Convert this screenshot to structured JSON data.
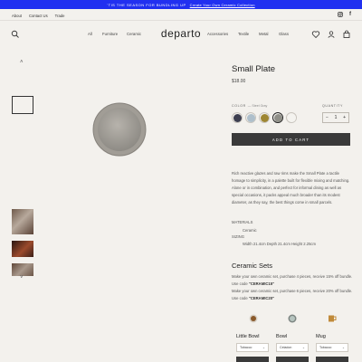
{
  "announcement": {
    "text": "'TIS THE SEASON FOR BUNDLING UP",
    "link": "Create Your Own Ceramic Collection"
  },
  "utility": {
    "links": [
      "About",
      "Contact Us",
      "Trade"
    ]
  },
  "nav": {
    "left_items": [
      "All",
      "Furniture",
      "Ceramic"
    ],
    "logo": "departo",
    "right_items": [
      "Accessories",
      "Textile",
      "Metal",
      "Glass"
    ]
  },
  "product": {
    "title": "Small Plate",
    "price": "$18.00",
    "color_label": "COLOR",
    "color_value": "— Steel Gray",
    "swatches": [
      {
        "name": "Midnight",
        "color": "#3d3f50"
      },
      {
        "name": "Sky",
        "color": "#aebfcb"
      },
      {
        "name": "Ochre",
        "color": "#9e8632"
      },
      {
        "name": "Steel Gray",
        "color": "#8f8f88"
      },
      {
        "name": "White",
        "color": "#f4f3ef"
      }
    ],
    "selected_swatch": "Steel Gray",
    "quantity_label": "QUANTITY",
    "quantity": "1",
    "add_to_cart": "ADD TO CART",
    "description": "Rich reactive glazes and raw rims make the Small Plate a tactile homage to simplicity, in a palette built for flexible mixing and matching. Alone or in combination, and perfect for informal dining as well as special occasions, it packs appeal much broader than its modest diameter, as they say, the best things come in small parcels.",
    "materials_label": "MATERIALS",
    "materials_value": "Ceramic",
    "sizing_label": "SIZING",
    "sizing_value": "Width 21.4cm Depth 21.4cm Height 2.25cm"
  },
  "sets": {
    "title": "Ceramic Sets",
    "p1_text": "Make your own ceramic set, purchase 4 pieces, receive 15% off bundle. Use code ",
    "p1_code": "\"CERAMIC15\"",
    "p2_text": "Make your own ceramic set, purchase 6 pieces, receive 20% off bundle. Use code ",
    "p2_code": "\"CERAMIC20\"",
    "items": [
      {
        "name": "Little Bowl",
        "select": "Tobacco",
        "color": "#8a5a2b"
      },
      {
        "name": "Bowl",
        "select": "Celadon",
        "color": "#b6c4bf"
      },
      {
        "name": "Mug",
        "select": "Tobacco",
        "color": "#c08a3a"
      }
    ]
  }
}
